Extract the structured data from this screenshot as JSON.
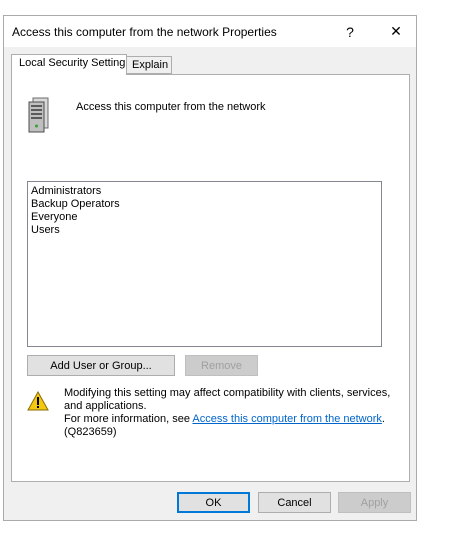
{
  "window": {
    "title": "Access this computer from the network Properties",
    "help_glyph": "?",
    "close_glyph": "✕"
  },
  "tabs": [
    {
      "label": "Local Security Setting",
      "active": true
    },
    {
      "label": "Explain",
      "active": false
    }
  ],
  "policy": {
    "icon": "server-icon",
    "name": "Access this computer from the network"
  },
  "members": [
    "Administrators",
    "Backup Operators",
    "Everyone",
    "Users"
  ],
  "buttons": {
    "add": "Add User or Group...",
    "remove": "Remove",
    "ok": "OK",
    "cancel": "Cancel",
    "apply": "Apply"
  },
  "warning": {
    "icon": "warning-icon",
    "line1": "Modifying this setting may affect compatibility with clients, services, and applications.",
    "more_prefix": "For more information, see ",
    "link_text": "Access this computer from the network",
    "more_suffix": ".",
    "kb": "(Q823659)"
  },
  "colors": {
    "accent": "#0078d7",
    "link": "#0066cc",
    "warning_yellow": "#f2c811"
  }
}
